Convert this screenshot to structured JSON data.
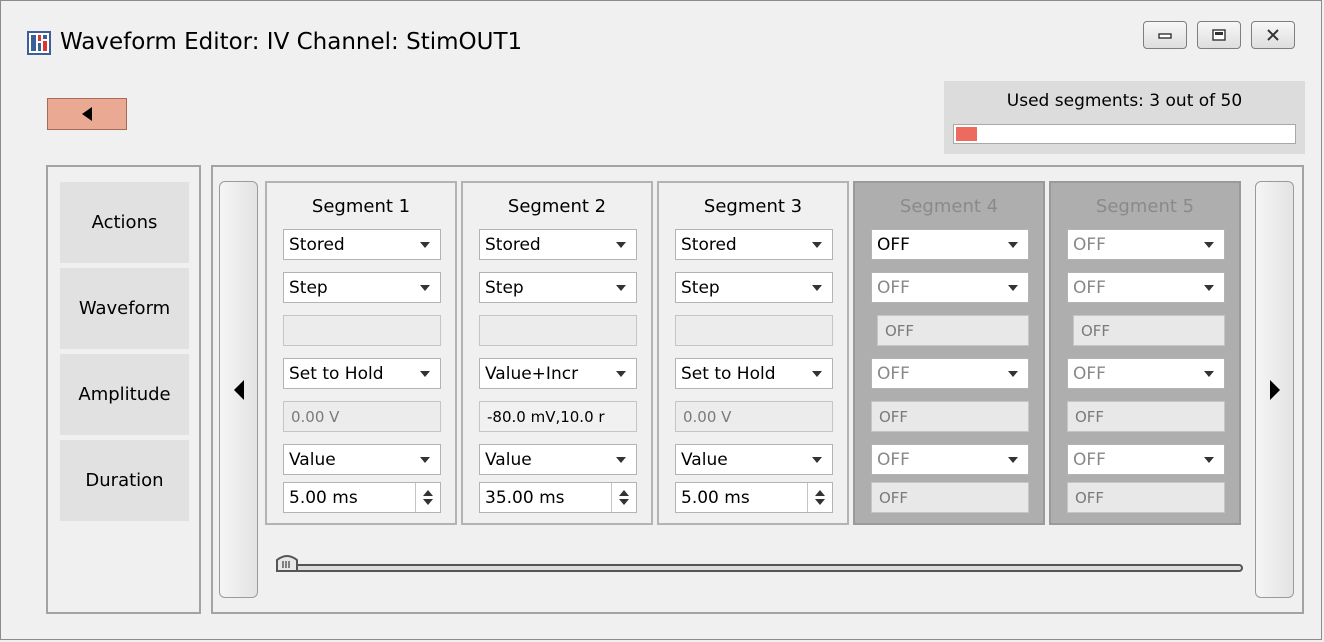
{
  "window": {
    "title": "Waveform Editor: IV Channel: StimOUT1"
  },
  "used_segments": {
    "label": "Used segments: 3 out of 50",
    "fraction": 0.06,
    "fill_color": "#ec6a5e"
  },
  "sidebar": {
    "items": [
      {
        "label": "Actions"
      },
      {
        "label": "Waveform"
      },
      {
        "label": "Amplitude"
      },
      {
        "label": "Duration"
      }
    ]
  },
  "segments": [
    {
      "header": "Segment 1",
      "store": "Stored",
      "waveform": "Step",
      "amp_mode": "Set to Hold",
      "amp_value": "0.00 V",
      "dur_mode": "Value",
      "dur_value": "5.00 ms"
    },
    {
      "header": "Segment 2",
      "store": "Stored",
      "waveform": "Step",
      "amp_mode": "Value+Incr",
      "amp_value": "-80.0 mV,10.0 r",
      "dur_mode": "Value",
      "dur_value": "35.00 ms"
    },
    {
      "header": "Segment 3",
      "store": "Stored",
      "waveform": "Step",
      "amp_mode": "Set to Hold",
      "amp_value": "0.00 V",
      "dur_mode": "Value",
      "dur_value": "5.00 ms"
    },
    {
      "header": "Segment 4",
      "store": "OFF",
      "waveform": "OFF",
      "param": "OFF",
      "amp_mode": "OFF",
      "amp_value": "OFF",
      "dur_mode": "OFF",
      "dur_value": "OFF"
    },
    {
      "header": "Segment 5",
      "store": "OFF",
      "waveform": "OFF",
      "param": "OFF",
      "amp_mode": "OFF",
      "amp_value": "OFF",
      "dur_mode": "OFF",
      "dur_value": "OFF"
    }
  ],
  "colors": {
    "back_button": "#e9a993",
    "inactive_segment": "#aeaeae"
  },
  "icons": {
    "app": "waveform-editor-icon",
    "back": "left-arrow-icon",
    "prev": "left-triangle-icon",
    "next": "right-triangle-icon",
    "minimize": "minimize-icon",
    "restore": "restore-icon",
    "close": "close-icon",
    "slider": "slider-thumb-icon"
  }
}
